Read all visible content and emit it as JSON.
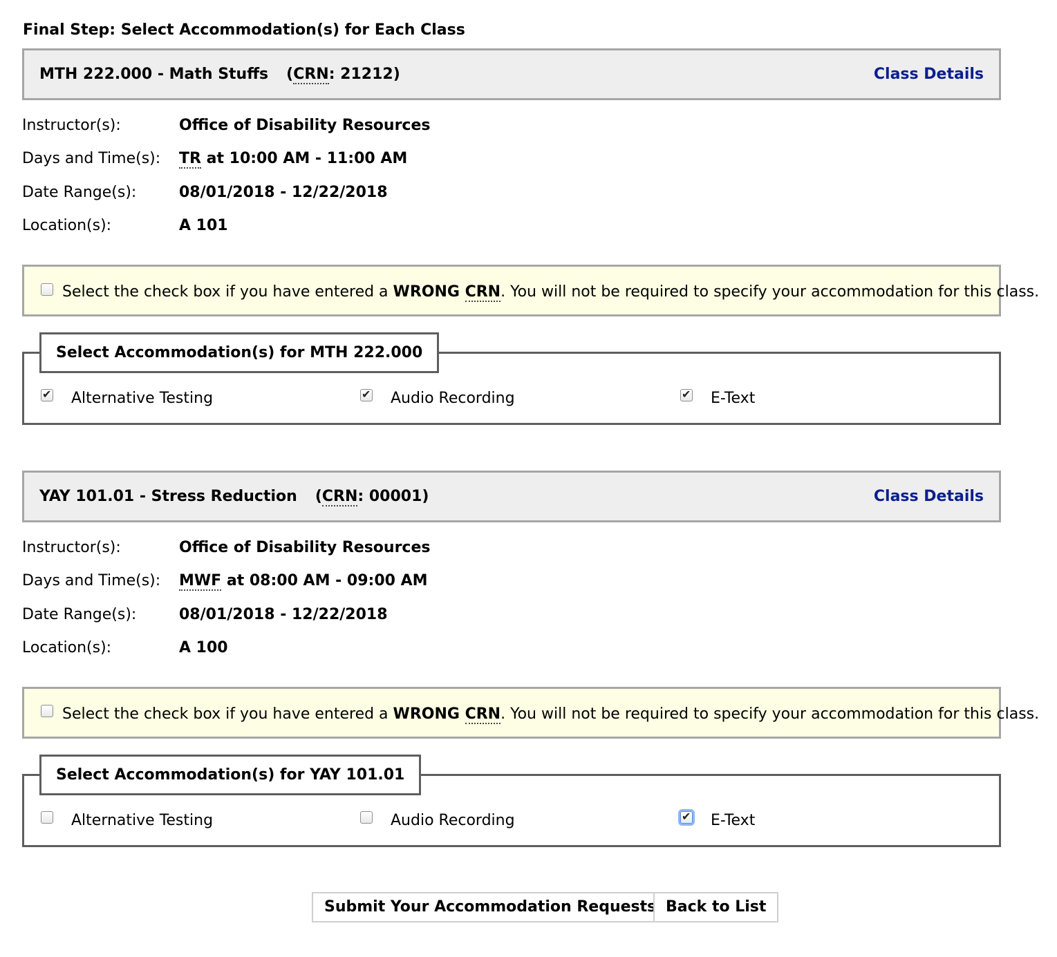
{
  "page_title": "Final Step: Select Accommodation(s) for Each Class",
  "labels": {
    "instructor": "Instructor(s):",
    "days_time": "Days and Time(s):",
    "date_range": "Date Range(s):",
    "location": "Location(s):",
    "class_details": "Class Details",
    "crn_abbr": "CRN",
    "notice_prefix": "Select the check box if you have entered a ",
    "notice_bold": "WRONG ",
    "notice_suffix": ". You will not be required to specify your accommodation for this class."
  },
  "courses": [
    {
      "code_title": "MTH 222.000 - Math Stuffs",
      "crn_value": ": 21212)",
      "instructor": "Office of Disability Resources",
      "days_abbr": "TR",
      "time": " at 10:00 AM - 11:00 AM",
      "date_range": "08/01/2018 - 12/22/2018",
      "location": "A 101",
      "wrong_crn_checked": false,
      "legend": "Select Accommodation(s) for MTH 222.000",
      "accommodations": [
        {
          "label": "Alternative Testing",
          "checked": true
        },
        {
          "label": "Audio Recording",
          "checked": true
        },
        {
          "label": "E-Text",
          "checked": true
        }
      ]
    },
    {
      "code_title": "YAY 101.01 - Stress Reduction",
      "crn_value": ": 00001)",
      "instructor": "Office of Disability Resources",
      "days_abbr": "MWF",
      "time": " at 08:00 AM - 09:00 AM",
      "date_range": "08/01/2018 - 12/22/2018",
      "location": "A 100",
      "wrong_crn_checked": false,
      "legend": "Select Accommodation(s) for YAY 101.01",
      "accommodations": [
        {
          "label": "Alternative Testing",
          "checked": false
        },
        {
          "label": "Audio Recording",
          "checked": false
        },
        {
          "label": "E-Text",
          "checked": true,
          "focused": true
        }
      ]
    }
  ],
  "buttons": {
    "submit": "Submit Your Accommodation Requests",
    "back": "Back to List"
  },
  "colors": {
    "link": "#0b1f8f",
    "header_bg": "#eeeeee",
    "notice_bg": "#fdfee3",
    "focus_ring": "#8fb6f5"
  }
}
